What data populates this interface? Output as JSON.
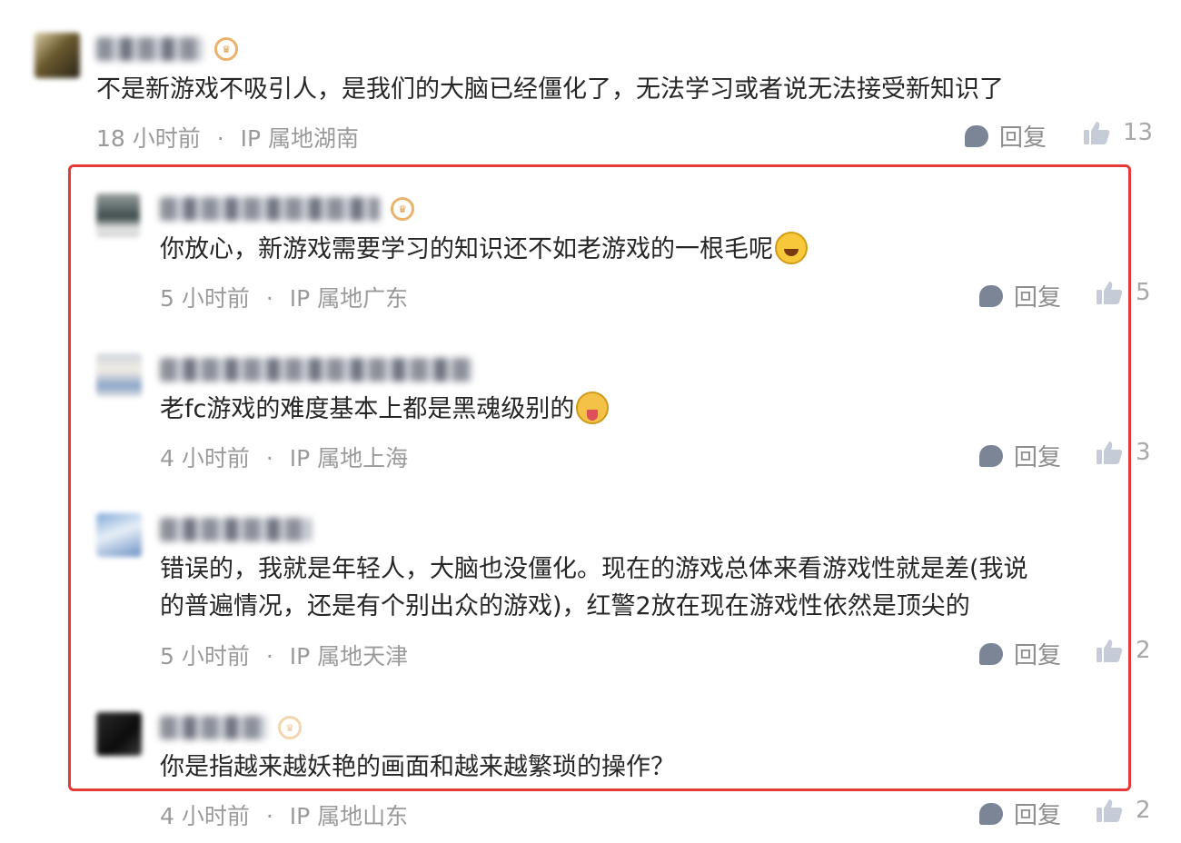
{
  "comments": [
    {
      "text": "不是新游戏不吸引人，是我们的大脑已经僵化了，无法学习或者说无法接受新知识了",
      "time": "18 小时前",
      "sep": "·",
      "ip": "IP 属地湖南",
      "reply_label": "回复",
      "likes": "13"
    },
    {
      "text": "你放心，新游戏需要学习的知识还不如老游戏的一根毛呢",
      "time": "5 小时前",
      "sep": "·",
      "ip": "IP 属地广东",
      "reply_label": "回复",
      "likes": "5",
      "emoji": "grinning-emoji"
    },
    {
      "text": "老fc游戏的难度基本上都是黑魂级别的",
      "time": "4 小时前",
      "sep": "·",
      "ip": "IP 属地上海",
      "reply_label": "回复",
      "likes": "3",
      "emoji": "tongue-out-emoji"
    },
    {
      "text_line1": "错误的，我就是年轻人，大脑也没僵化。现在的游戏总体来看游戏性就是差(我说",
      "text_line2": "的普遍情况，还是有个别出众的游戏)，红警2放在现在游戏性依然是顶尖的",
      "time": "5 小时前",
      "sep": "·",
      "ip": "IP 属地天津",
      "reply_label": "回复",
      "likes": "2"
    },
    {
      "text": "你是指越来越妖艳的画面和越来越繁琐的操作？",
      "time": "4 小时前",
      "sep": "·",
      "ip": "IP 属地山东",
      "reply_label": "回复",
      "likes": "2"
    }
  ],
  "colors": {
    "highlight_border": "#e53a3a",
    "meta_text": "#9a9a9a",
    "badge": "#e9b36c"
  }
}
